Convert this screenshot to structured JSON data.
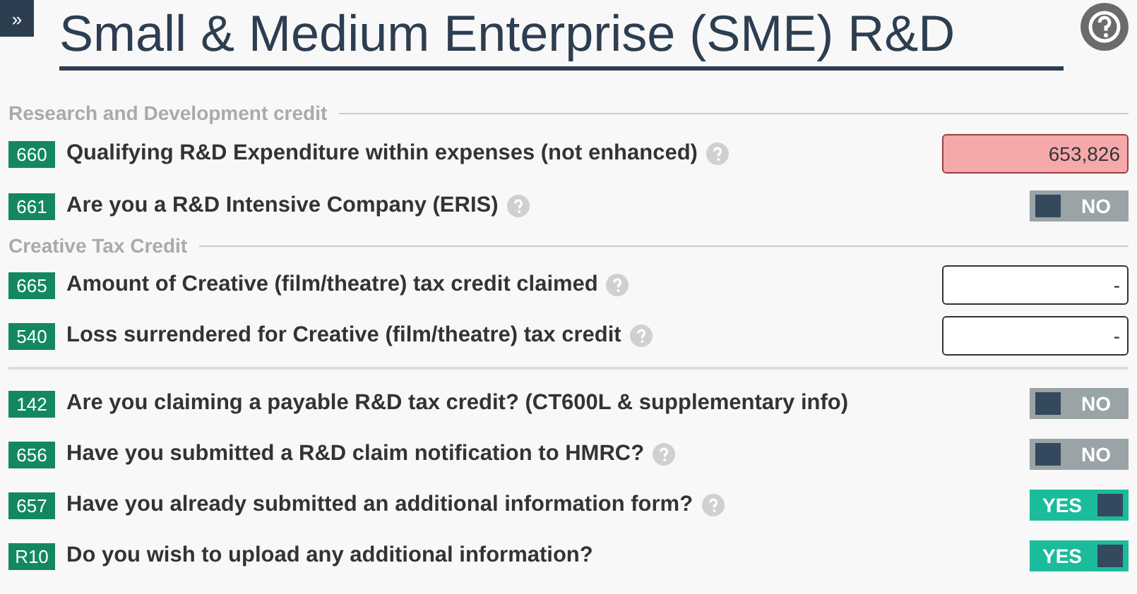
{
  "expand_button": "»",
  "title": "Small & Medium Enterprise (SME) R&D",
  "sections": [
    {
      "title": "Research and Development credit",
      "rows": [
        {
          "code": "660",
          "label": "Qualifying R&D Expenditure within expenses (not enhanced)",
          "help": true,
          "kind": "field",
          "value": "653,826",
          "error": true
        },
        {
          "code": "661",
          "label": "Are you a R&D Intensive Company (ERIS)",
          "help": true,
          "kind": "toggle",
          "on": false,
          "text": "NO"
        }
      ]
    },
    {
      "title": "Creative Tax Credit",
      "rows": [
        {
          "code": "665",
          "label": "Amount of Creative (film/theatre) tax credit claimed",
          "help": true,
          "kind": "field",
          "value": "-",
          "error": false
        },
        {
          "code": "540",
          "label": "Loss surrendered for Creative (film/theatre) tax credit",
          "help": true,
          "kind": "field",
          "value": "-",
          "error": false
        }
      ]
    },
    {
      "rows": [
        {
          "code": "142",
          "label": "Are you claiming a payable R&D tax credit? (CT600L & supplementary info)",
          "help": false,
          "kind": "toggle",
          "on": false,
          "text": "NO"
        },
        {
          "code": "656",
          "label": "Have you submitted a R&D claim notification to HMRC?",
          "help": true,
          "kind": "toggle",
          "on": false,
          "text": "NO"
        },
        {
          "code": "657",
          "label": "Have you already submitted an additional information form?",
          "help": true,
          "kind": "toggle",
          "on": true,
          "text": "YES"
        },
        {
          "code": "R10",
          "label": "Do you wish to upload any additional information?",
          "help": false,
          "kind": "toggle",
          "on": true,
          "text": "YES"
        }
      ]
    }
  ]
}
